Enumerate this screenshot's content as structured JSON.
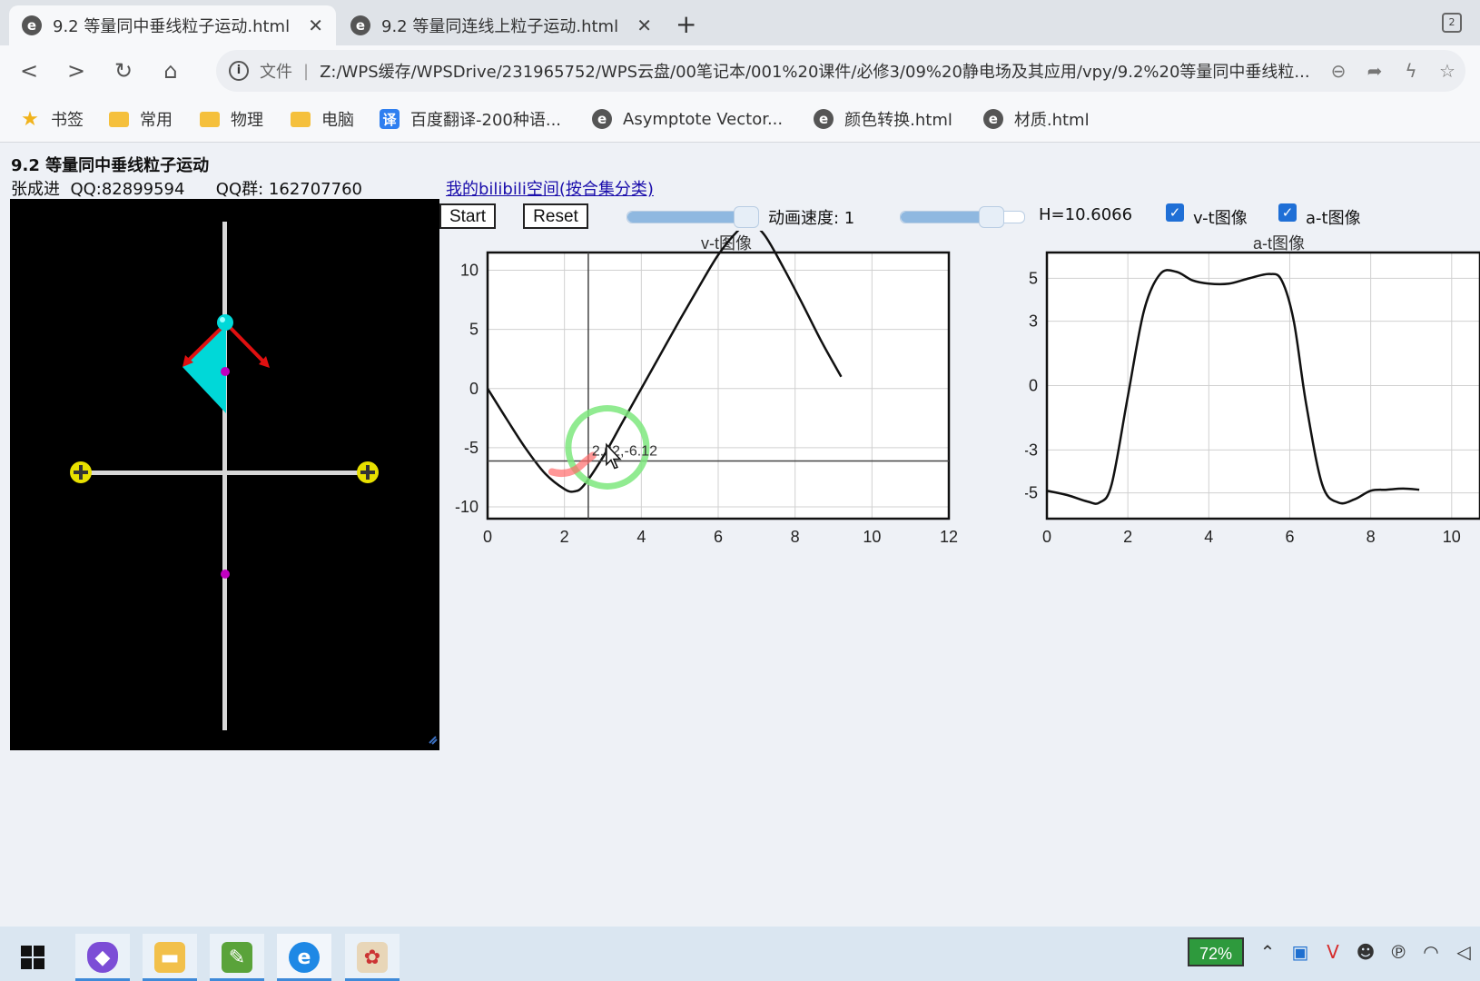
{
  "browser": {
    "tabs": [
      {
        "title": "9.2 等量同中垂线粒子运动.html",
        "active": true
      },
      {
        "title": "9.2 等量同连线上粒子运动.html",
        "active": false
      }
    ],
    "new_tab": "+",
    "tab_count": "2",
    "address": {
      "scheme_label": "文件",
      "url": "Z:/WPS缓存/WPSDrive/231965752/WPS云盘/00笔记本/001%20课件/必修3/09%20静电场及其应用/vpy/9.2%20等量同中垂线粒..."
    },
    "bookmarks": [
      {
        "label": "书签",
        "icon": "star-icon"
      },
      {
        "label": "常用",
        "icon": "folder-icon"
      },
      {
        "label": "物理",
        "icon": "folder-icon"
      },
      {
        "label": "电脑",
        "icon": "folder-icon"
      },
      {
        "label": "百度翻译-200种语...",
        "icon": "translate-icon"
      },
      {
        "label": "Asymptote Vector...",
        "icon": "edge-icon"
      },
      {
        "label": "颜色转换.html",
        "icon": "edge-icon"
      },
      {
        "label": "材质.html",
        "icon": "edge-icon"
      }
    ]
  },
  "page": {
    "title": "9.2 等量同中垂线粒子运动",
    "author_line": "张成进  QQ:82899594      QQ群: 162707760",
    "bilibili_link": "我的bilibili空间(按合集分类)"
  },
  "controls": {
    "start_label": "Start",
    "reset_label": "Reset",
    "speed_label": "动画速度: 1",
    "speed_slider_value": 0.9,
    "height_slider_value": 0.73,
    "h_label": "H=10.6066",
    "vt_checkbox": {
      "label": "v-t图像",
      "checked": true
    },
    "at_checkbox": {
      "label": "a-t图像",
      "checked": true
    }
  },
  "colors": {
    "particle": "#00d8d8",
    "arrow": "#e01010",
    "charge": "#e8e000",
    "marker": "#c000c0",
    "rod": "#d8d8d8",
    "link": "#1a0dab",
    "cursor_ring": "#7ee87e"
  },
  "charts": {
    "vt": {
      "title": "v-t图像",
      "xticks": [
        "0",
        "2",
        "4",
        "6",
        "8",
        "10",
        "12"
      ],
      "yticks": [
        "10",
        "5",
        "0",
        "-5",
        "-10"
      ],
      "hover_label": "2.62,-6.12"
    },
    "at": {
      "title": "a-t图像",
      "xticks": [
        "0",
        "2",
        "4",
        "6",
        "8",
        "10"
      ],
      "yticks": [
        "5",
        "3",
        "0",
        "-3",
        "-5"
      ]
    }
  },
  "chart_data": [
    {
      "type": "line",
      "title": "v-t图像",
      "xlim": [
        0,
        12
      ],
      "ylim": [
        -11,
        11.5
      ],
      "crosshair": {
        "x": 2.62,
        "y": -6.12
      },
      "x": [
        0,
        0.5,
        1.0,
        1.5,
        2.0,
        2.25,
        2.5,
        3.0,
        3.5,
        4.0,
        4.5,
        5.0,
        5.5,
        6.0,
        6.5,
        6.8,
        7.2,
        7.7,
        8.2,
        8.7,
        9.2
      ],
      "y": [
        0,
        -2.6,
        -5.1,
        -7.2,
        -8.5,
        -8.7,
        -8.2,
        -5.8,
        -2.9,
        0,
        2.9,
        5.8,
        8.6,
        11.3,
        13.3,
        14.0,
        13.0,
        10.2,
        7.1,
        3.9,
        1.0
      ]
    },
    {
      "type": "line",
      "title": "a-t图像",
      "xlim": [
        0,
        10.7
      ],
      "ylim": [
        -6.2,
        6.2
      ],
      "x": [
        0,
        0.5,
        1.0,
        1.3,
        1.6,
        2.0,
        2.4,
        2.8,
        3.2,
        3.6,
        4.0,
        4.5,
        5.0,
        5.5,
        5.8,
        6.1,
        6.4,
        6.8,
        7.2,
        7.6,
        8.0,
        8.4,
        8.8,
        9.2
      ],
      "y": [
        -4.9,
        -5.1,
        -5.4,
        -5.45,
        -4.6,
        -0.5,
        3.5,
        5.2,
        5.3,
        4.9,
        4.75,
        4.75,
        5.0,
        5.2,
        4.9,
        3.0,
        -0.8,
        -4.6,
        -5.45,
        -5.3,
        -4.9,
        -4.85,
        -4.8,
        -4.85
      ]
    }
  ],
  "taskbar": {
    "apps": [
      "windows-start-icon",
      "obsidian-icon",
      "file-explorer-icon",
      "editor-icon",
      "edge-browser-icon",
      "paint-icon"
    ],
    "battery": "72%"
  }
}
